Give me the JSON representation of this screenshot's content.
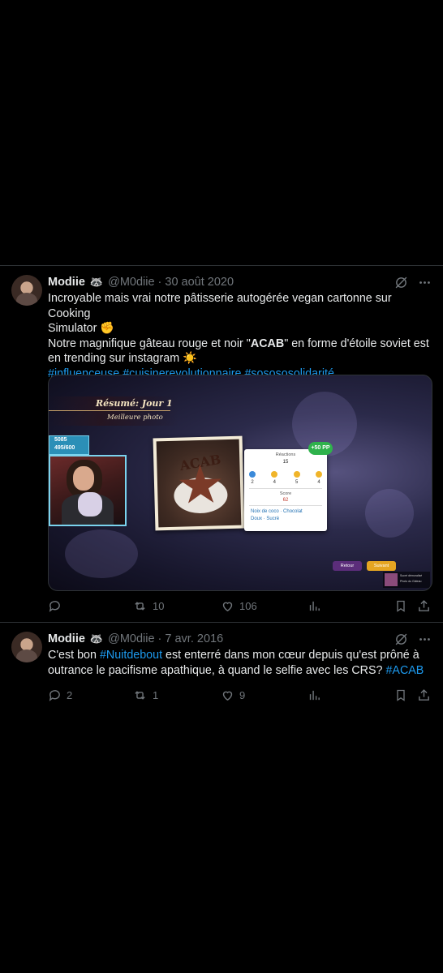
{
  "tweets": [
    {
      "author_name": "Modiie",
      "author_badge": "🦝",
      "handle": "@M0diie",
      "separator": "·",
      "date": "30 août 2020",
      "text_lines": {
        "line1": "Incroyable mais vrai notre pâtisserie autogérée vegan cartonne sur Cooking",
        "line2_text": "Simulator",
        "line2_emoji": "✊",
        "line3_before": "Notre magnifique gâteau rouge et noir \"",
        "line3_bold": "ACAB",
        "line3_after": "\" en forme d'étoile soviet est",
        "line4_text": "en trending sur instagram",
        "line4_emoji": "☀️",
        "hashtags": [
          "#influenceuse",
          "#cuisinerevolutionnaire",
          "#sosososolidarité"
        ]
      },
      "media": {
        "summary_title": "Résumé: Jour 1",
        "best_photo": "Meilleure photo",
        "sub_count": "5085",
        "sub_goal": "495/600",
        "photo_text": "ACAB",
        "reactions_label": "Réactions",
        "reactions_total": "15",
        "reaction_counts": [
          "2",
          "4",
          "5",
          "4"
        ],
        "score_label": "Score",
        "score_value": "62",
        "tags": [
          "Noix de coco",
          "Chocolat",
          "Doux",
          "Sucré"
        ],
        "pp_badge": "+50 PP",
        "back_button": "Retour",
        "next_button": "Suivant",
        "mini_line1": "Sucré démoralisé",
        "mini_line2": "Photo du Gâteau"
      },
      "stats": {
        "replies": "",
        "retweets": "10",
        "likes": "106"
      }
    },
    {
      "author_name": "Modiie",
      "author_badge": "🦝",
      "handle": "@M0diie",
      "separator": "·",
      "date": "7 avr. 2016",
      "text_lines": {
        "l1_before": "C'est bon ",
        "l1_tag": "#Nuitdebout",
        "l1_after": " est enterré dans mon cœur depuis qu'est prôné à",
        "l2_before": "outrance le pacifisme apathique, à quand le selfie avec les CRS? ",
        "l2_tag": "#ACAB"
      },
      "stats": {
        "replies": "2",
        "retweets": "1",
        "likes": "9"
      }
    }
  ],
  "colors": {
    "background": "#000000",
    "text": "#e7e9ea",
    "muted": "#71767b",
    "link": "#1d9bf0",
    "divider": "#2f3336"
  },
  "icons": [
    "grok-icon",
    "more-icon",
    "reply-icon",
    "retweet-icon",
    "like-icon",
    "views-icon",
    "bookmark-icon",
    "share-icon"
  ]
}
